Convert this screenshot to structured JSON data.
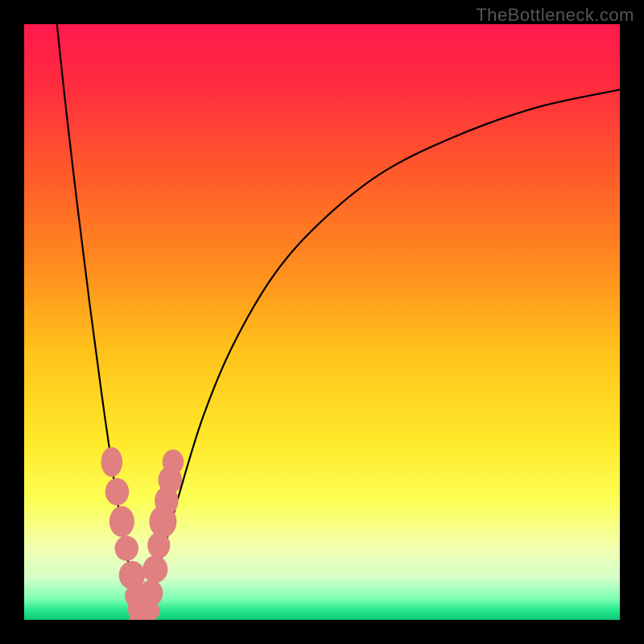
{
  "watermark": "TheBottleneck.com",
  "chart_data": {
    "type": "line",
    "title": "",
    "xlabel": "",
    "ylabel": "",
    "xlim": [
      0,
      100
    ],
    "ylim": [
      0,
      100
    ],
    "grid": false,
    "legend": false,
    "background_gradient_stops": [
      {
        "offset": 0.0,
        "color": "#ff1a4d"
      },
      {
        "offset": 0.1,
        "color": "#ff2b3f"
      },
      {
        "offset": 0.25,
        "color": "#ff5a2a"
      },
      {
        "offset": 0.4,
        "color": "#ff8a1f"
      },
      {
        "offset": 0.55,
        "color": "#ffc21a"
      },
      {
        "offset": 0.7,
        "color": "#ffe92a"
      },
      {
        "offset": 0.8,
        "color": "#fcff55"
      },
      {
        "offset": 0.88,
        "color": "#f3ffb0"
      },
      {
        "offset": 0.93,
        "color": "#d4ffc8"
      },
      {
        "offset": 0.965,
        "color": "#7dffb4"
      },
      {
        "offset": 0.985,
        "color": "#21e68a"
      },
      {
        "offset": 1.0,
        "color": "#10c878"
      }
    ],
    "series": [
      {
        "name": "left-branch",
        "x": [
          5.5,
          7,
          9,
          11,
          13,
          15,
          16.5,
          18,
          19,
          19.8
        ],
        "y": [
          100,
          86,
          69,
          53,
          38,
          24,
          15,
          7,
          2.5,
          0
        ]
      },
      {
        "name": "right-branch",
        "x": [
          19.8,
          21,
          23,
          26,
          30,
          35,
          42,
          50,
          60,
          72,
          86,
          100
        ],
        "y": [
          0,
          3,
          10,
          21,
          34,
          46,
          58,
          67,
          75,
          81,
          86,
          89
        ]
      }
    ],
    "points": {
      "name": "highlight-dots",
      "color": "#e08080",
      "x": [
        14.7,
        15.6,
        16.4,
        17.2,
        18.1,
        18.8,
        19.4,
        19.9,
        20.6,
        21.3,
        22.0,
        22.6,
        23.3,
        23.9,
        24.5,
        25.0
      ],
      "y": [
        26.5,
        21.5,
        16.5,
        12.0,
        7.5,
        4.0,
        1.8,
        0.3,
        1.5,
        4.5,
        8.5,
        12.5,
        16.5,
        20.0,
        23.5,
        26.5
      ],
      "rx": [
        1.8,
        2.0,
        2.1,
        2.0,
        2.2,
        1.9,
        2.0,
        2.2,
        2.2,
        2.0,
        2.1,
        1.9,
        2.3,
        2.0,
        2.0,
        1.8
      ],
      "ry": [
        2.5,
        2.3,
        2.6,
        2.1,
        2.4,
        2.0,
        2.0,
        1.8,
        1.8,
        2.2,
        2.3,
        2.2,
        2.7,
        2.4,
        2.3,
        2.1
      ]
    }
  }
}
